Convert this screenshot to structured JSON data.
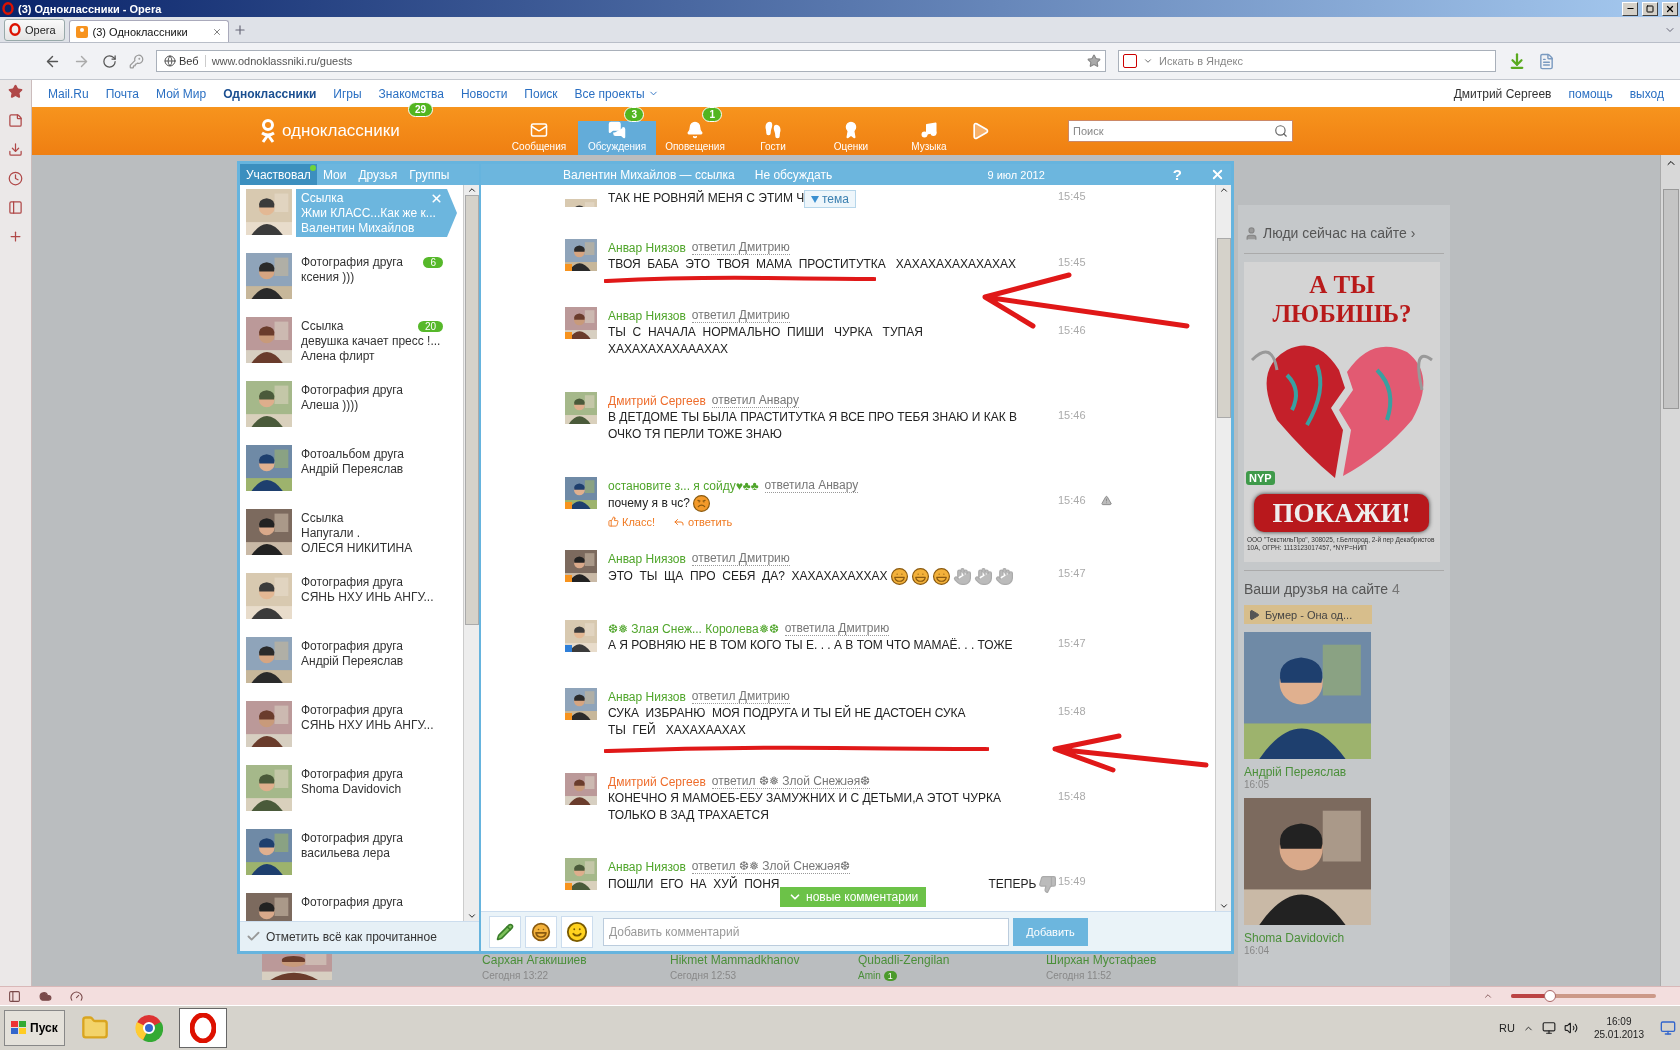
{
  "window": {
    "title": "(3) Одноклассники - Opera"
  },
  "browser": {
    "menu_button": "Opera",
    "tabs": [
      {
        "label": "(3) Одноклассники",
        "selected": true
      }
    ],
    "address_badge": "Веб",
    "url": "www.odnoklassniki.ru/guests",
    "search_placeholder": "Искать в Яндекс"
  },
  "portal_nav": {
    "links": [
      {
        "label": "Mail.Ru",
        "selected": false
      },
      {
        "label": "Почта",
        "selected": false
      },
      {
        "label": "Мой Мир",
        "selected": false
      },
      {
        "label": "Одноклассники",
        "selected": true
      },
      {
        "label": "Игры",
        "selected": false
      },
      {
        "label": "Знакомства",
        "selected": false
      },
      {
        "label": "Новости",
        "selected": false
      },
      {
        "label": "Поиск",
        "selected": false
      }
    ],
    "all_projects": "Все проекты",
    "user": "Дмитрий Сергеев",
    "right_links": [
      "помощь",
      "выход"
    ]
  },
  "header": {
    "logo": "одноклассники",
    "logo_badge": "29",
    "search_placeholder": "Поиск",
    "items": [
      {
        "kind": "messages",
        "label": "Сообщения",
        "selected": false
      },
      {
        "kind": "discussions",
        "label": "Обсуждения",
        "badge": "3",
        "selected": true
      },
      {
        "kind": "alerts",
        "label": "Оповещения",
        "badge": "1",
        "selected": false
      },
      {
        "kind": "guests",
        "label": "Гости",
        "selected": false
      },
      {
        "kind": "ratings",
        "label": "Оценки",
        "selected": false
      },
      {
        "kind": "music",
        "label": "Музыка",
        "selected": false
      }
    ]
  },
  "discussions": {
    "tabs": [
      {
        "label": "Участвовал",
        "selected": true,
        "new": true
      },
      {
        "label": "Мои",
        "selected": false,
        "new": false
      },
      {
        "label": "Друзья",
        "selected": false,
        "new": false
      },
      {
        "label": "Группы",
        "selected": false,
        "new": false
      }
    ],
    "items": [
      {
        "type": "Ссылка",
        "lines": [
          "Жми КЛАСС...Как же к...",
          "Валентин Михайлов"
        ],
        "selected": true
      },
      {
        "type": "Фотография друга",
        "lines": [
          "ксения )))"
        ],
        "badge": "6",
        "selected": false
      },
      {
        "type": "Ссылка",
        "lines": [
          "девушка качает пресс !...",
          "Алена флирт"
        ],
        "badge": "20",
        "selected": false
      },
      {
        "type": "Фотография друга",
        "lines": [
          "Алеша ))))"
        ],
        "selected": false
      },
      {
        "type": "Фотоальбом друга",
        "lines": [
          "Андрій Переяслав"
        ],
        "selected": false
      },
      {
        "type": "Ссылка",
        "lines": [
          "Напугали .",
          "ОЛЕСЯ НИКИТИНА"
        ],
        "selected": false
      },
      {
        "type": "Фотография друга",
        "lines": [
          "СЯНЬ НХУ ИНЬ АНГУ..."
        ],
        "selected": false
      },
      {
        "type": "Фотография друга",
        "lines": [
          "Андрій Переяслав"
        ],
        "selected": false
      },
      {
        "type": "Фотография друга",
        "lines": [
          "СЯНЬ НХУ ИНЬ АНГУ..."
        ],
        "selected": false
      },
      {
        "type": "Фотография друга",
        "lines": [
          "Shoma Davidovich"
        ],
        "selected": false
      },
      {
        "type": "Фотография друга",
        "lines": [
          "васильева лера"
        ],
        "selected": false
      },
      {
        "type": "Фотография друга",
        "selected": false
      }
    ],
    "mark_all": "Отметить всё как прочитанное"
  },
  "chat": {
    "title": "Валентин Михайлов — ссылка",
    "unfollow": "Не обсуждать",
    "date": "9 июл 2012",
    "help": "?",
    "topic_button": "тема",
    "new_comments": "новые комментарии",
    "comment_placeholder": "Добавить комментарий",
    "submit": "Добавить",
    "comments": [
      {
        "kind": "partial",
        "lines": [
          "ТАК НЕ РОВНЯЙ МЕНЯ С ЭТИМ Ч"
        ],
        "time": "15:45"
      },
      {
        "kind": "full",
        "author": "Анвар Ниязов",
        "color": "#4fa52a",
        "reply": "ответил Дмитрию",
        "presence": {
          "color": "#f7931e"
        },
        "lines": [
          "ТВОЯ  БАБА  ЭТО  ТВОЯ  МАМА  ПРОСТИТУТКА   ХАХАХАХАХАХАХАХ"
        ],
        "time": "15:45",
        "hovered": false,
        "annotated": true
      },
      {
        "kind": "full",
        "author": "Анвар Ниязов",
        "color": "#4fa52a",
        "reply": "ответил Дмитрию",
        "presence": {
          "color": "#f7931e"
        },
        "lines": [
          "ТЫ  С  НАЧАЛА  НОРМАЛЬНО  ПИШИ   ЧУРКА   ТУПАЯ",
          "ХАХАХАХАХАААХАХ"
        ],
        "time": "15:46",
        "hovered": false,
        "annotated": false
      },
      {
        "kind": "full",
        "author": "Дмитрий Сергеев",
        "color": "#ee6d2c",
        "reply": "ответил Анвару",
        "lines": [
          "В ДЕТДОМЕ ТЫ БЫЛА ПРАСТИТУТКА Я ВСЕ ПРО ТЕБЯ ЗНАЮ И КАК В",
          "ОЧКО ТЯ ПЕРЛИ ТОЖЕ ЗНАЮ"
        ],
        "time": "15:46",
        "hovered": false,
        "annotated": false
      },
      {
        "kind": "full",
        "author": "остановите з... я сойду♥♣♣",
        "color": "#4fa52a",
        "reply": "ответила Анвару",
        "presence": {
          "color": "#f7931e"
        },
        "lines": [
          "почему я в чс?"
        ],
        "emoticons": [
          {
            "kind": "angry"
          }
        ],
        "actions": [
          "Класс!",
          "ответить"
        ],
        "time": "15:46",
        "hovered": true,
        "annotated": false
      },
      {
        "kind": "full",
        "author": "Анвар Ниязов",
        "color": "#4fa52a",
        "reply": "ответил Дмитрию",
        "presence": {
          "color": "#f7931e"
        },
        "lines": [
          "ЭТО  ТЫ  ЩА  ПРО  СЕБЯ  ДА?  ХАХАХАХАХХАХ"
        ],
        "emoticons": [
          {
            "kind": "grin"
          },
          {
            "kind": "grin"
          },
          {
            "kind": "grin"
          },
          {
            "kind": "peace"
          },
          {
            "kind": "peace"
          },
          {
            "kind": "peace"
          }
        ],
        "time": "15:47",
        "hovered": false,
        "annotated": false
      },
      {
        "kind": "full",
        "author": "❆❅ Злая Снеж... Королева❅❆",
        "color": "#4fa52a",
        "reply": "ответила Дмитрию",
        "presence": {
          "color": "#2f7fd8"
        },
        "lines": [
          "А Я РОВНЯЮ НЕ В ТОМ КОГО ТЫ Е. . . А В ТОМ ЧТО МАМАЁ. . . ТОЖЕ"
        ],
        "time": "15:47",
        "hovered": false,
        "annotated": false
      },
      {
        "kind": "full",
        "author": "Анвар Ниязов",
        "color": "#4fa52a",
        "reply": "ответил Дмитрию",
        "presence": {
          "color": "#f7931e"
        },
        "lines": [
          "СУКА  ИЗБРАНЮ  МОЯ ПОДРУГА И ТЫ ЕЙ НЕ ДАСТОЕН СУКА",
          "ТЫ  ГЕЙ   ХАХАХААХАХ"
        ],
        "time": "15:48",
        "hovered": false,
        "annotated": true
      },
      {
        "kind": "full",
        "author": "Дмитрий Сергеев",
        "color": "#ee6d2c",
        "reply": "ответил ❆❅ Злой Снежɹəя❆",
        "lines": [
          "КОНЕЧНО Я МАМОЕБ-ЕБУ ЗАМУЖНИХ И С ДЕТЬМИ,А ЭТОТ ЧУРКА",
          "ТОЛЬКО В ЗАД ТРАХАЕТСЯ"
        ],
        "time": "15:48",
        "hovered": false,
        "annotated": false
      },
      {
        "kind": "full",
        "author": "Анвар Ниязов",
        "color": "#4fa52a",
        "reply": "ответил ❆❅ Злой Снежɹəя❆",
        "presence": {
          "color": "#f7931e"
        },
        "lines": [
          "ПОШЛИ  ЕГО  НА  ХУЙ  ПОНЯ"
        ],
        "tail": "ТЕПЕРЬ",
        "emoticons": [
          {
            "kind": "thumbs-down"
          }
        ],
        "time": "15:49",
        "hovered": false,
        "annotated": false
      }
    ]
  },
  "sidebar": {
    "people_online": "Люди сейчас на сайте ›",
    "ad": {
      "headline": "А ТЫ ЛЮБИШЬ?",
      "badge": "NYP",
      "button": "ПОКАЖИ!",
      "fine_print": "ООО \"ТекстильПро\", 308025, г.Белгород, 2-й пер Декабристов 10А, ОГРН: 1113123017457, *NYP=НИП"
    },
    "friends_title": "Ваши друзья на сайте",
    "friends_count": "4",
    "now_playing": "Бумер - Она од...",
    "friends": [
      {
        "name": "Андрій Переяслав",
        "time": "16:05"
      },
      {
        "name": "Shoma Davidovich",
        "time": "16:04"
      }
    ]
  },
  "guests": [
    {
      "name": "Сархан Агакишиев",
      "time": "Сегодня 13:22"
    },
    {
      "name": "Hikmet Mammadkhanov",
      "time": "Сегодня 12:53"
    },
    {
      "name": "Qubadli-Zengilan",
      "status": "Amin",
      "badge": "1"
    },
    {
      "name": "Ширхан Мустафаев",
      "time": "Сегодня 11:52"
    }
  ],
  "status_bar": {
    "zoom": {
      "level": 0.27
    }
  },
  "taskbar": {
    "start": "Пуск",
    "apps": [
      {
        "kind": "folder",
        "selected": false
      },
      {
        "kind": "chrome",
        "selected": false
      },
      {
        "kind": "opera",
        "selected": true
      }
    ],
    "language": "RU",
    "time": "16:09",
    "date": "25.01.2013"
  }
}
